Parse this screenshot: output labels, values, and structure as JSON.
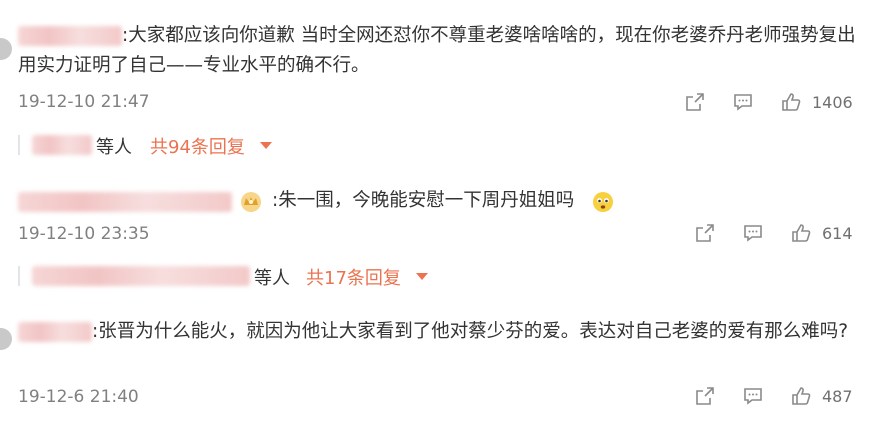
{
  "comments": [
    {
      "text": ":大家都应该向你道歉 当时全网还怼你不尊重老婆啥啥啥的，现在你老婆乔丹老师强势复出用实力证明了自己——专业水平的确不行。",
      "time": "19-12-10 21:47",
      "likes": "1406",
      "reply_suffix": "等人",
      "reply_count": "共94条回复"
    },
    {
      "text": ":朱一围，今晚能安慰一下周丹姐姐吗",
      "time": "19-12-10 23:35",
      "likes": "614",
      "reply_suffix": "等人",
      "reply_count": "共17条回复"
    },
    {
      "text": ":张晋为什么能火，就因为他让大家看到了他对蔡少芬的爱。表达对自己老婆的爱有那么难吗?",
      "time": "19-12-6 21:40",
      "likes": "487"
    }
  ],
  "icons": {
    "share": "share-icon",
    "comment": "comment-icon",
    "like": "thumbs-up-icon",
    "caret": "caret-down-icon",
    "badge": "crown-badge-icon",
    "emoji": "worried-face-emoji"
  },
  "colors": {
    "reply_accent": "#eb7350",
    "timestamp": "#808080",
    "name_blur": "#f2c4c4"
  }
}
